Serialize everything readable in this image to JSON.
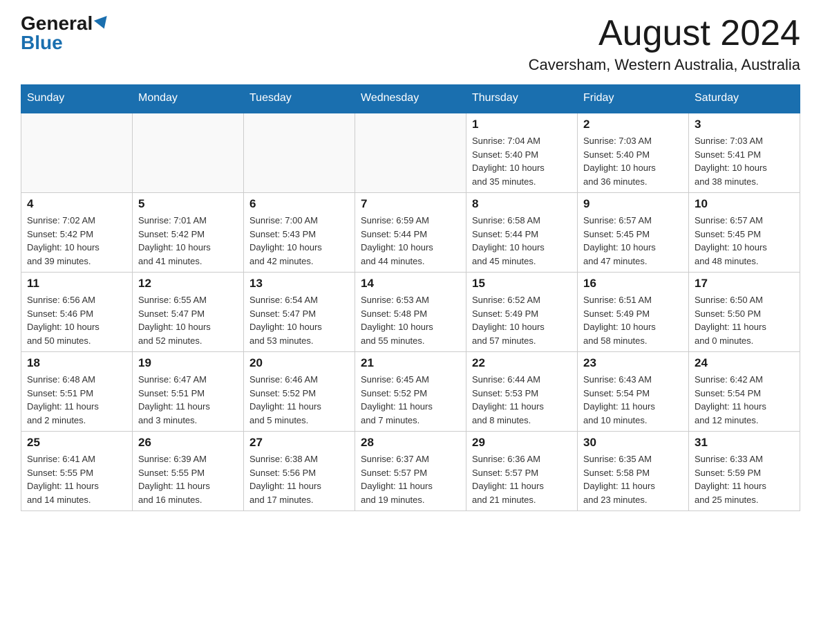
{
  "header": {
    "logo_general": "General",
    "logo_blue": "Blue",
    "month_title": "August 2024",
    "location": "Caversham, Western Australia, Australia"
  },
  "columns": [
    "Sunday",
    "Monday",
    "Tuesday",
    "Wednesday",
    "Thursday",
    "Friday",
    "Saturday"
  ],
  "weeks": [
    [
      {
        "day": "",
        "info": ""
      },
      {
        "day": "",
        "info": ""
      },
      {
        "day": "",
        "info": ""
      },
      {
        "day": "",
        "info": ""
      },
      {
        "day": "1",
        "info": "Sunrise: 7:04 AM\nSunset: 5:40 PM\nDaylight: 10 hours\nand 35 minutes."
      },
      {
        "day": "2",
        "info": "Sunrise: 7:03 AM\nSunset: 5:40 PM\nDaylight: 10 hours\nand 36 minutes."
      },
      {
        "day": "3",
        "info": "Sunrise: 7:03 AM\nSunset: 5:41 PM\nDaylight: 10 hours\nand 38 minutes."
      }
    ],
    [
      {
        "day": "4",
        "info": "Sunrise: 7:02 AM\nSunset: 5:42 PM\nDaylight: 10 hours\nand 39 minutes."
      },
      {
        "day": "5",
        "info": "Sunrise: 7:01 AM\nSunset: 5:42 PM\nDaylight: 10 hours\nand 41 minutes."
      },
      {
        "day": "6",
        "info": "Sunrise: 7:00 AM\nSunset: 5:43 PM\nDaylight: 10 hours\nand 42 minutes."
      },
      {
        "day": "7",
        "info": "Sunrise: 6:59 AM\nSunset: 5:44 PM\nDaylight: 10 hours\nand 44 minutes."
      },
      {
        "day": "8",
        "info": "Sunrise: 6:58 AM\nSunset: 5:44 PM\nDaylight: 10 hours\nand 45 minutes."
      },
      {
        "day": "9",
        "info": "Sunrise: 6:57 AM\nSunset: 5:45 PM\nDaylight: 10 hours\nand 47 minutes."
      },
      {
        "day": "10",
        "info": "Sunrise: 6:57 AM\nSunset: 5:45 PM\nDaylight: 10 hours\nand 48 minutes."
      }
    ],
    [
      {
        "day": "11",
        "info": "Sunrise: 6:56 AM\nSunset: 5:46 PM\nDaylight: 10 hours\nand 50 minutes."
      },
      {
        "day": "12",
        "info": "Sunrise: 6:55 AM\nSunset: 5:47 PM\nDaylight: 10 hours\nand 52 minutes."
      },
      {
        "day": "13",
        "info": "Sunrise: 6:54 AM\nSunset: 5:47 PM\nDaylight: 10 hours\nand 53 minutes."
      },
      {
        "day": "14",
        "info": "Sunrise: 6:53 AM\nSunset: 5:48 PM\nDaylight: 10 hours\nand 55 minutes."
      },
      {
        "day": "15",
        "info": "Sunrise: 6:52 AM\nSunset: 5:49 PM\nDaylight: 10 hours\nand 57 minutes."
      },
      {
        "day": "16",
        "info": "Sunrise: 6:51 AM\nSunset: 5:49 PM\nDaylight: 10 hours\nand 58 minutes."
      },
      {
        "day": "17",
        "info": "Sunrise: 6:50 AM\nSunset: 5:50 PM\nDaylight: 11 hours\nand 0 minutes."
      }
    ],
    [
      {
        "day": "18",
        "info": "Sunrise: 6:48 AM\nSunset: 5:51 PM\nDaylight: 11 hours\nand 2 minutes."
      },
      {
        "day": "19",
        "info": "Sunrise: 6:47 AM\nSunset: 5:51 PM\nDaylight: 11 hours\nand 3 minutes."
      },
      {
        "day": "20",
        "info": "Sunrise: 6:46 AM\nSunset: 5:52 PM\nDaylight: 11 hours\nand 5 minutes."
      },
      {
        "day": "21",
        "info": "Sunrise: 6:45 AM\nSunset: 5:52 PM\nDaylight: 11 hours\nand 7 minutes."
      },
      {
        "day": "22",
        "info": "Sunrise: 6:44 AM\nSunset: 5:53 PM\nDaylight: 11 hours\nand 8 minutes."
      },
      {
        "day": "23",
        "info": "Sunrise: 6:43 AM\nSunset: 5:54 PM\nDaylight: 11 hours\nand 10 minutes."
      },
      {
        "day": "24",
        "info": "Sunrise: 6:42 AM\nSunset: 5:54 PM\nDaylight: 11 hours\nand 12 minutes."
      }
    ],
    [
      {
        "day": "25",
        "info": "Sunrise: 6:41 AM\nSunset: 5:55 PM\nDaylight: 11 hours\nand 14 minutes."
      },
      {
        "day": "26",
        "info": "Sunrise: 6:39 AM\nSunset: 5:55 PM\nDaylight: 11 hours\nand 16 minutes."
      },
      {
        "day": "27",
        "info": "Sunrise: 6:38 AM\nSunset: 5:56 PM\nDaylight: 11 hours\nand 17 minutes."
      },
      {
        "day": "28",
        "info": "Sunrise: 6:37 AM\nSunset: 5:57 PM\nDaylight: 11 hours\nand 19 minutes."
      },
      {
        "day": "29",
        "info": "Sunrise: 6:36 AM\nSunset: 5:57 PM\nDaylight: 11 hours\nand 21 minutes."
      },
      {
        "day": "30",
        "info": "Sunrise: 6:35 AM\nSunset: 5:58 PM\nDaylight: 11 hours\nand 23 minutes."
      },
      {
        "day": "31",
        "info": "Sunrise: 6:33 AM\nSunset: 5:59 PM\nDaylight: 11 hours\nand 25 minutes."
      }
    ]
  ]
}
